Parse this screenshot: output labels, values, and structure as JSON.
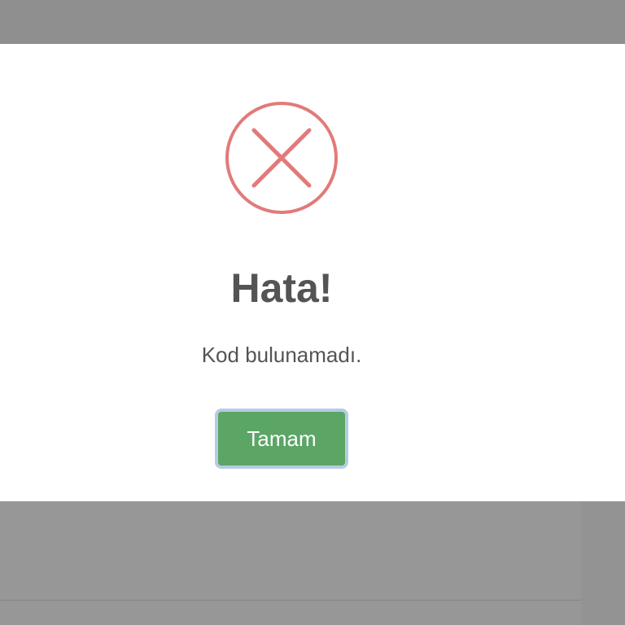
{
  "dialog": {
    "icon": "error-x-circle-icon",
    "title": "Hata!",
    "message": "Kod bulunamadı.",
    "confirm_label": "Tamam"
  },
  "colors": {
    "error_icon": "#e27a7a",
    "confirm_button": "#5ba565",
    "confirm_focus_ring": "#b7cbe4",
    "text": "#545454",
    "overlay": "#8e8e8e"
  }
}
